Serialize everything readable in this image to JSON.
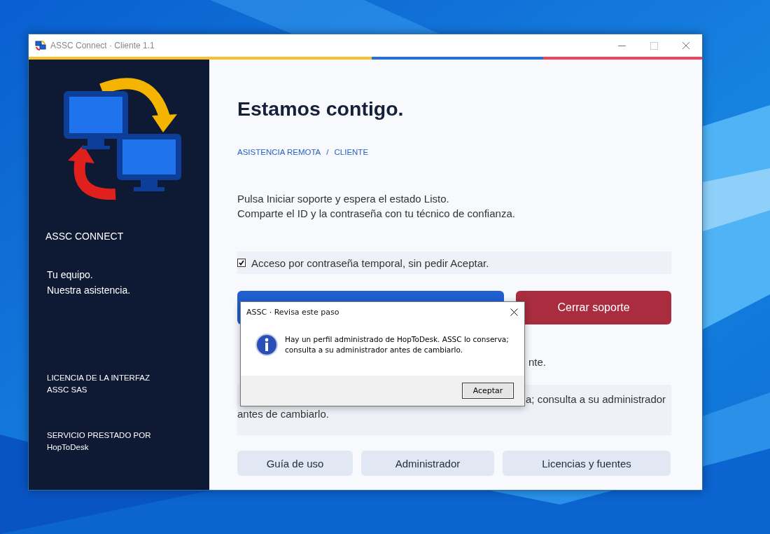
{
  "window": {
    "title": "ASSC Connect · Cliente 1.1"
  },
  "sidebar": {
    "brand": "ASSC CONNECT",
    "tagline": [
      "Tu equipo.",
      "Nuestra asistencia."
    ],
    "license": [
      "LICENCIA DE LA INTERFAZ",
      "ASSC SAS"
    ],
    "service": [
      "SERVICIO PRESTADO POR",
      "HopToDesk"
    ]
  },
  "main": {
    "heading": "Estamos contigo.",
    "breadcrumb": [
      "ASISTENCIA REMOTA",
      "/",
      "CLIENTE"
    ],
    "instructions": [
      "Pulsa Iniciar soporte y espera el estado Listo.",
      "Comparte el ID y la contraseña con tu técnico de confianza."
    ],
    "checkbox": {
      "label": "Acceso por contraseña temporal, sin pedir Aceptar.",
      "checked": true
    },
    "buttons": [
      {
        "kind": "primary"
      },
      {
        "kind": "danger",
        "label": "Cerrar soporte"
      }
    ],
    "status_fragment": "nte.",
    "notice_fragments": [
      "a; consulta a su administrador",
      "antes de cambiarlo."
    ],
    "footer_buttons": [
      "Guía de uso",
      "Administrador",
      "Licencias y fuentes"
    ]
  },
  "dialog": {
    "title": "ASSC · Revisa este paso",
    "message": [
      "Hay un perfil administrado de HopToDesk. ASSC lo conserva;",
      "consulta a su administrador antes de cambiarlo."
    ],
    "button": "Aceptar"
  }
}
